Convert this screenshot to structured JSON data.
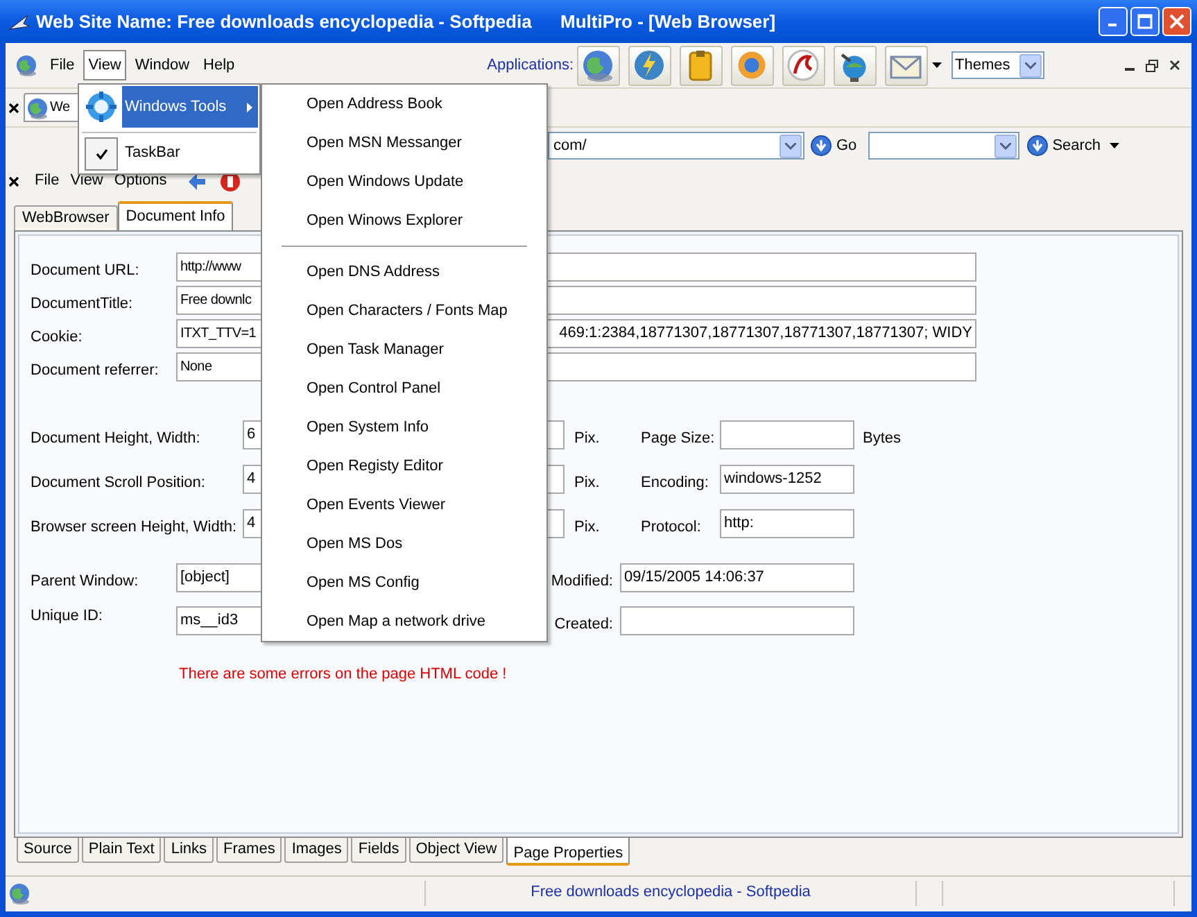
{
  "window": {
    "title": "Web Site Name: Free downloads encyclopedia - Softpedia",
    "app_title": "MultiPro - [Web Browser]"
  },
  "menu_bar": {
    "items": [
      {
        "label": "File",
        "selected": false
      },
      {
        "label": "View",
        "selected": true
      },
      {
        "label": "Window",
        "selected": false
      },
      {
        "label": "Help",
        "selected": false
      }
    ],
    "applications_label": "Applications:",
    "themes": "Themes"
  },
  "browser_tab": {
    "label": "We"
  },
  "address_bar": {
    "value": "com/",
    "go": "Go",
    "search": "Search"
  },
  "page_menu": [
    "File",
    "View",
    "Options"
  ],
  "view_menu": {
    "items": [
      {
        "kind": "submenu",
        "label": "Windows Tools",
        "selected": true
      },
      {
        "kind": "check",
        "label": "TaskBar",
        "checked": true
      }
    ]
  },
  "windows_tools_menu": {
    "items": [
      {
        "kind": "item",
        "label": "Open Address Book"
      },
      {
        "kind": "item",
        "label": "Open MSN Messanger"
      },
      {
        "kind": "item",
        "label": "Open Windows Update"
      },
      {
        "kind": "item",
        "label": "Open Winows Explorer"
      },
      {
        "kind": "separator"
      },
      {
        "kind": "item",
        "label": "Open DNS Address"
      },
      {
        "kind": "item",
        "label": "Open Characters / Fonts Map"
      },
      {
        "kind": "item",
        "label": "Open Task Manager"
      },
      {
        "kind": "item",
        "label": "Open Control Panel"
      },
      {
        "kind": "item",
        "label": "Open System Info"
      },
      {
        "kind": "item",
        "label": "Open Registy Editor"
      },
      {
        "kind": "item",
        "label": "Open Events Viewer"
      },
      {
        "kind": "item",
        "label": "Open MS Dos"
      },
      {
        "kind": "item",
        "label": "Open MS Config"
      },
      {
        "kind": "item",
        "label": "Open Map a network drive"
      }
    ]
  },
  "top_tabs": [
    {
      "label": "WebBrowser",
      "selected": false
    },
    {
      "label": "Document Info",
      "selected": true
    }
  ],
  "info_fields": [
    {
      "label": "Document URL:",
      "value": "http://www"
    },
    {
      "label": "DocumentTitle:",
      "value": "Free downlc"
    },
    {
      "label": "Cookie:",
      "value": "ITXT_TTV=1",
      "value_end": "469:1:2384,18771307,18771307,18771307,18771307; WIDY"
    },
    {
      "label": "Document referrer:",
      "value": "None"
    }
  ],
  "metrics": [
    {
      "label": "Document  Height, Width:",
      "value": "6",
      "unit": "Pix.",
      "side_label": "Page Size:",
      "side_unit": "Bytes"
    },
    {
      "label": "Document Scroll Position:",
      "value": "4",
      "unit": "Pix.",
      "side_label": "Encoding:",
      "side_value": "windows-1252"
    },
    {
      "label": "Browser screen Height, Width:",
      "value": "4",
      "unit": "Pix.",
      "side_label": "Protocol:",
      "side_value": "http:"
    }
  ],
  "details": [
    {
      "label": "Parent Window:",
      "value": "[object]",
      "side_label": "Modified:",
      "side_value": "09/15/2005 14:06:37"
    },
    {
      "label": "Unique ID:",
      "value": "ms__id3",
      "side_label": "Created:"
    }
  ],
  "error": "There are some errors on the page HTML code !",
  "bottom_tabs": [
    {
      "label": "Source",
      "selected": false
    },
    {
      "label": "Plain Text",
      "selected": false
    },
    {
      "label": "Links",
      "selected": false
    },
    {
      "label": "Frames",
      "selected": false
    },
    {
      "label": "Images",
      "selected": false
    },
    {
      "label": "Fields",
      "selected": false
    },
    {
      "label": "Object View",
      "selected": false
    },
    {
      "label": "Page Properties",
      "selected": true
    }
  ],
  "status_bar": {
    "text": "Free downloads encyclopedia - Softpedia"
  }
}
